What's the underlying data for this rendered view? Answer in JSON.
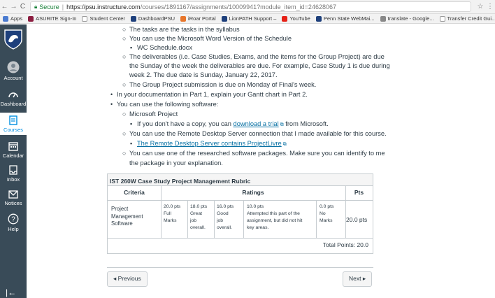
{
  "browser": {
    "secure_label": "Secure",
    "url_host": "https://psu.instructure.com",
    "url_path": "/courses/1891167/assignments/10009941?module_item_id=24628067"
  },
  "bookmarks": [
    {
      "label": "Apps",
      "color": "#4a7bd0"
    },
    {
      "label": "ASURITE Sign-In",
      "color": "#8c1d40"
    },
    {
      "label": "Student Center",
      "color": "#ffffff"
    },
    {
      "label": "DashboardPSU",
      "color": "#1e407c"
    },
    {
      "label": "iRoar Portal",
      "color": "#e8762b"
    },
    {
      "label": "LionPATH Support –",
      "color": "#1e407c"
    },
    {
      "label": "YouTube",
      "color": "#e62117"
    },
    {
      "label": "Penn State WebMai...",
      "color": "#1e407c"
    },
    {
      "label": "translate - Google...",
      "color": "#888888"
    },
    {
      "label": "Transfer Credit Gui...",
      "color": "#ffffff"
    }
  ],
  "global_nav": {
    "items": [
      {
        "label": "Account",
        "icon": "account-icon"
      },
      {
        "label": "Dashboard",
        "icon": "dashboard-icon"
      },
      {
        "label": "Courses",
        "icon": "courses-icon"
      },
      {
        "label": "Calendar",
        "icon": "calendar-icon"
      },
      {
        "label": "Inbox",
        "icon": "inbox-icon"
      },
      {
        "label": "Notices",
        "icon": "notices-icon"
      },
      {
        "label": "Help",
        "icon": "help-icon"
      }
    ],
    "collapse_glyph": "|←"
  },
  "assignment": {
    "sub1": "The tasks are the tasks in the syllabus",
    "sub2": "You can use the Microsoft Word Version of the Schedule",
    "sub2a": "WC Schedule.docx",
    "sub3_line1": "The deliverables (i.e. Case Studies, Exams, and the items for the Group Project) are due",
    "sub3_line2": "the Sunday of the week the deliverables are due.  For example, Case Study 1 is due during",
    "sub3_line3": "week 2.  The due date is Sunday, January 22, 2017.",
    "sub4": "The Group Project submission is due on Monday of Final's week.",
    "main2": "In your documentation in Part 1, explain your Gantt chart in Part 2.",
    "main3": "You can use the following software:",
    "sw1": "Microsoft Project",
    "sw1a_before": "If you don't have a copy, you can ",
    "sw1a_link": "download a trial",
    "sw1a_after": " from Microsoft.",
    "sw2": "You can use the Remote Desktop Server connection that I made available for this course.",
    "sw2a_link": "The Remote Desktop Server contains ProjectLivre",
    "sw3_line1": "You can use one of the researched software packages. Make sure you can identify to me",
    "sw3_line2": "the package in your explanation."
  },
  "rubric": {
    "title": "IST 260W Case Study Project Management Rubric",
    "headers": {
      "criteria": "Criteria",
      "ratings": "Ratings",
      "pts": "Pts"
    },
    "criterion": [
      "Project",
      "Management",
      "Software"
    ],
    "ratings": [
      {
        "pts": "20.0 pts",
        "desc": [
          "Full",
          "Marks"
        ]
      },
      {
        "pts": "18.0 pts",
        "desc": [
          "Great",
          "job",
          "overall."
        ]
      },
      {
        "pts": "16.0 pts",
        "desc": [
          "Good",
          "job",
          "overall."
        ]
      },
      {
        "pts": "10.0 pts",
        "desc": [
          "Attempted this part of the",
          "assignment, but did not hit",
          "key areas."
        ]
      },
      {
        "pts": "0.0 pts",
        "desc": [
          "No",
          "Marks"
        ]
      }
    ],
    "points": "20.0 pts",
    "total": "Total Points: 20.0"
  },
  "pager": {
    "previous": "◂ Previous",
    "next": "Next ▸"
  }
}
